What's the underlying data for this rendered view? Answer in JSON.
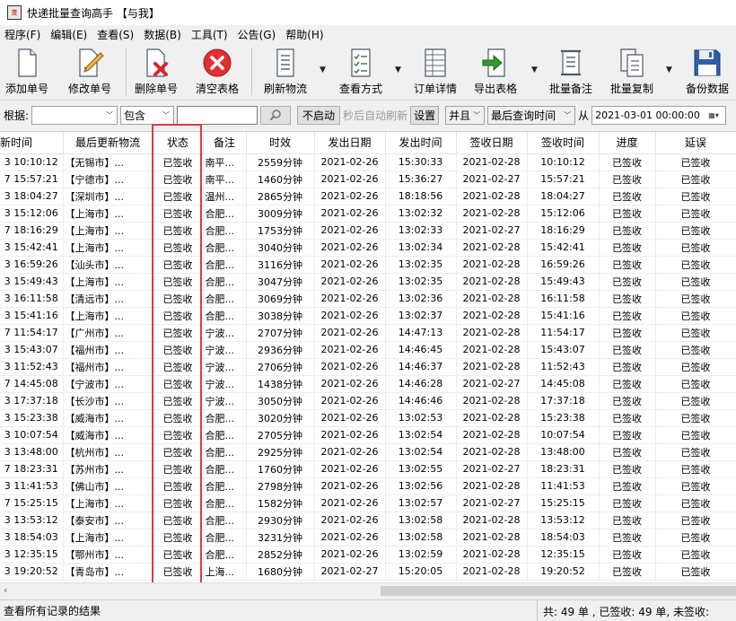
{
  "window": {
    "title": "快递批量查询高手 【与我】",
    "icon_text": "查"
  },
  "menu": [
    "程序(F)",
    "编辑(E)",
    "查看(S)",
    "数据(B)",
    "工具(T)",
    "公告(G)",
    "帮助(H)"
  ],
  "toolbar": {
    "add": "添加单号",
    "edit": "修改单号",
    "delete": "删除单号",
    "clear": "清空表格",
    "refresh": "刷新物流",
    "view": "查看方式",
    "detail": "订单详情",
    "export": "导出表格",
    "note": "批量备注",
    "copy": "批量复制",
    "backup": "备份数据"
  },
  "filter": {
    "by_label": "根据:",
    "field_value": "",
    "op_value": "包含",
    "keyword": "",
    "auto_btn": "不启动",
    "auto_text": "秒后自动刷新",
    "settings_btn": "设置",
    "logic_value": "并且",
    "time_field": "最后查询时间",
    "from_label": "从",
    "from_value": "2021-03-01 00:00:00"
  },
  "table": {
    "headers": [
      "新时间",
      "最后更新物流",
      "状态",
      "备注",
      "时效",
      "发出日期",
      "发出时间",
      "签收日期",
      "签收时间",
      "进度",
      "延误"
    ],
    "rows": [
      [
        "3 10:10:12",
        "【无锡市】...",
        "已签收",
        "南平...",
        "2559分钟",
        "2021-02-26",
        "15:30:33",
        "2021-02-28",
        "10:10:12",
        "已签收",
        "已签收"
      ],
      [
        "7 15:57:21",
        "【宁德市】...",
        "已签收",
        "南平...",
        "1460分钟",
        "2021-02-26",
        "15:36:27",
        "2021-02-27",
        "15:57:21",
        "已签收",
        "已签收"
      ],
      [
        "3 18:04:27",
        "【深圳市】...",
        "已签收",
        "温州...",
        "2865分钟",
        "2021-02-26",
        "18:18:56",
        "2021-02-28",
        "18:04:27",
        "已签收",
        "已签收"
      ],
      [
        "3 15:12:06",
        "【上海市】...",
        "已签收",
        "合肥...",
        "3009分钟",
        "2021-02-26",
        "13:02:32",
        "2021-02-28",
        "15:12:06",
        "已签收",
        "已签收"
      ],
      [
        "7 18:16:29",
        "【上海市】...",
        "已签收",
        "合肥...",
        "1753分钟",
        "2021-02-26",
        "13:02:33",
        "2021-02-27",
        "18:16:29",
        "已签收",
        "已签收"
      ],
      [
        "3 15:42:41",
        "【上海市】...",
        "已签收",
        "合肥...",
        "3040分钟",
        "2021-02-26",
        "13:02:34",
        "2021-02-28",
        "15:42:41",
        "已签收",
        "已签收"
      ],
      [
        "3 16:59:26",
        "【汕头市】...",
        "已签收",
        "合肥...",
        "3116分钟",
        "2021-02-26",
        "13:02:35",
        "2021-02-28",
        "16:59:26",
        "已签收",
        "已签收"
      ],
      [
        "3 15:49:43",
        "【上海市】...",
        "已签收",
        "合肥...",
        "3047分钟",
        "2021-02-26",
        "13:02:35",
        "2021-02-28",
        "15:49:43",
        "已签收",
        "已签收"
      ],
      [
        "3 16:11:58",
        "【清远市】...",
        "已签收",
        "合肥...",
        "3069分钟",
        "2021-02-26",
        "13:02:36",
        "2021-02-28",
        "16:11:58",
        "已签收",
        "已签收"
      ],
      [
        "3 15:41:16",
        "【上海市】...",
        "已签收",
        "合肥...",
        "3038分钟",
        "2021-02-26",
        "13:02:37",
        "2021-02-28",
        "15:41:16",
        "已签收",
        "已签收"
      ],
      [
        "7 11:54:17",
        "【广州市】...",
        "已签收",
        "宁波...",
        "2707分钟",
        "2021-02-26",
        "14:47:13",
        "2021-02-28",
        "11:54:17",
        "已签收",
        "已签收"
      ],
      [
        "3 15:43:07",
        "【福州市】...",
        "已签收",
        "宁波...",
        "2936分钟",
        "2021-02-26",
        "14:46:45",
        "2021-02-28",
        "15:43:07",
        "已签收",
        "已签收"
      ],
      [
        "3 11:52:43",
        "【福州市】...",
        "已签收",
        "宁波...",
        "2706分钟",
        "2021-02-26",
        "14:46:37",
        "2021-02-28",
        "11:52:43",
        "已签收",
        "已签收"
      ],
      [
        "7 14:45:08",
        "【宁波市】...",
        "已签收",
        "宁波...",
        "1438分钟",
        "2021-02-26",
        "14:46:28",
        "2021-02-27",
        "14:45:08",
        "已签收",
        "已签收"
      ],
      [
        "3 17:37:18",
        "【长沙市】...",
        "已签收",
        "宁波...",
        "3050分钟",
        "2021-02-26",
        "14:46:46",
        "2021-02-28",
        "17:37:18",
        "已签收",
        "已签收"
      ],
      [
        "3 15:23:38",
        "【威海市】...",
        "已签收",
        "合肥...",
        "3020分钟",
        "2021-02-26",
        "13:02:53",
        "2021-02-28",
        "15:23:38",
        "已签收",
        "已签收"
      ],
      [
        "3 10:07:54",
        "【威海市】...",
        "已签收",
        "合肥...",
        "2705分钟",
        "2021-02-26",
        "13:02:54",
        "2021-02-28",
        "10:07:54",
        "已签收",
        "已签收"
      ],
      [
        "3 13:48:00",
        "【杭州市】...",
        "已签收",
        "合肥...",
        "2925分钟",
        "2021-02-26",
        "13:02:54",
        "2021-02-28",
        "13:48:00",
        "已签收",
        "已签收"
      ],
      [
        "7 18:23:31",
        "【苏州市】...",
        "已签收",
        "合肥...",
        "1760分钟",
        "2021-02-26",
        "13:02:55",
        "2021-02-27",
        "18:23:31",
        "已签收",
        "已签收"
      ],
      [
        "3 11:41:53",
        "【佛山市】...",
        "已签收",
        "合肥...",
        "2798分钟",
        "2021-02-26",
        "13:02:56",
        "2021-02-28",
        "11:41:53",
        "已签收",
        "已签收"
      ],
      [
        "7 15:25:15",
        "【上海市】...",
        "已签收",
        "合肥...",
        "1582分钟",
        "2021-02-26",
        "13:02:57",
        "2021-02-27",
        "15:25:15",
        "已签收",
        "已签收"
      ],
      [
        "3 13:53:12",
        "【泰安市】...",
        "已签收",
        "合肥...",
        "2930分钟",
        "2021-02-26",
        "13:02:58",
        "2021-02-28",
        "13:53:12",
        "已签收",
        "已签收"
      ],
      [
        "3 18:54:03",
        "【上海市】...",
        "已签收",
        "合肥...",
        "3231分钟",
        "2021-02-26",
        "13:02:58",
        "2021-02-28",
        "18:54:03",
        "已签收",
        "已签收"
      ],
      [
        "3 12:35:15",
        "【鄂州市】...",
        "已签收",
        "合肥...",
        "2852分钟",
        "2021-02-26",
        "13:02:59",
        "2021-02-28",
        "12:35:15",
        "已签收",
        "已签收"
      ],
      [
        "3 19:20:52",
        "【青岛市】...",
        "已签收",
        "上海...",
        "1680分钟",
        "2021-02-27",
        "15:20:05",
        "2021-02-28",
        "19:20:52",
        "已签收",
        "已签收"
      ]
    ]
  },
  "status": {
    "left": "查看所有记录的结果",
    "right": "共: 49 单 , 已签收: 49 单, 未签收:"
  },
  "colors": {
    "highlight": "#e03a3a",
    "delete_x": "#d9262b",
    "export_arrow": "#2e9a2e"
  }
}
